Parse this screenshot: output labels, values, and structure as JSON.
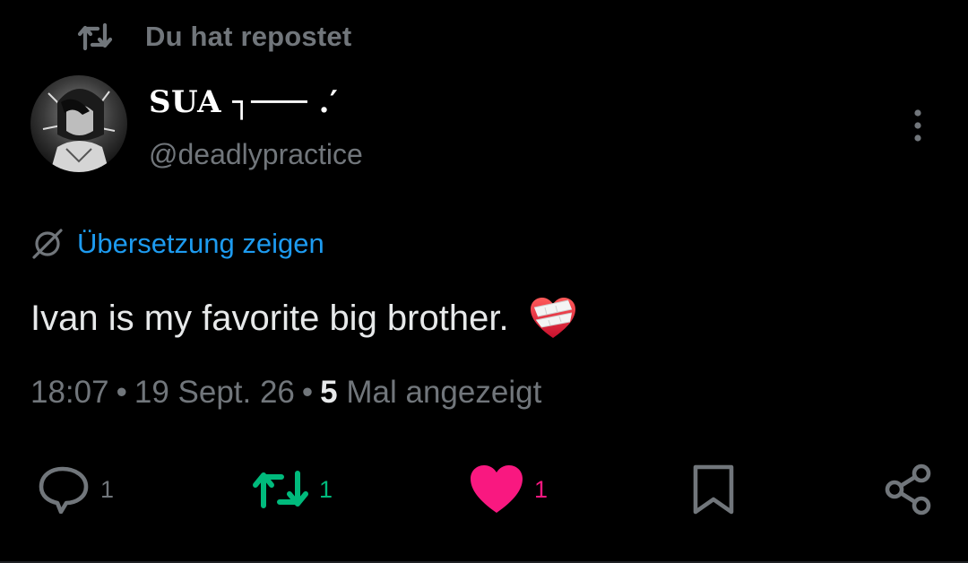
{
  "repost_banner": {
    "label": "Du hat repostet",
    "icon": "repost-icon"
  },
  "author": {
    "display_name": "SUA ┐─── .′",
    "handle": "@deadlypractice",
    "avatar": "avatar-image"
  },
  "more_menu_icon": "more-vertical-icon",
  "translate": {
    "label": "Übersetzung zeigen",
    "icon": "globe-icon"
  },
  "post": {
    "text": "Ivan is my favorite big brother.",
    "emoji": "mending-heart-emoji"
  },
  "meta": {
    "time": "18:07",
    "date": "19 Sept. 26",
    "separator": "•",
    "views_count": "5",
    "views_label": "Mal angezeigt"
  },
  "actions": {
    "reply": {
      "icon": "reply-icon",
      "count": "1"
    },
    "repost": {
      "icon": "repost-icon",
      "count": "1",
      "active": true
    },
    "like": {
      "icon": "heart-icon",
      "count": "1",
      "active": true
    },
    "bookmark": {
      "icon": "bookmark-icon"
    },
    "share": {
      "icon": "share-icon"
    }
  },
  "colors": {
    "background": "#000000",
    "primary_text": "#e7e9ea",
    "secondary_text": "#71767b",
    "link": "#1d9bf0",
    "repost_green": "#00ba7c",
    "like_pink": "#f91880"
  }
}
